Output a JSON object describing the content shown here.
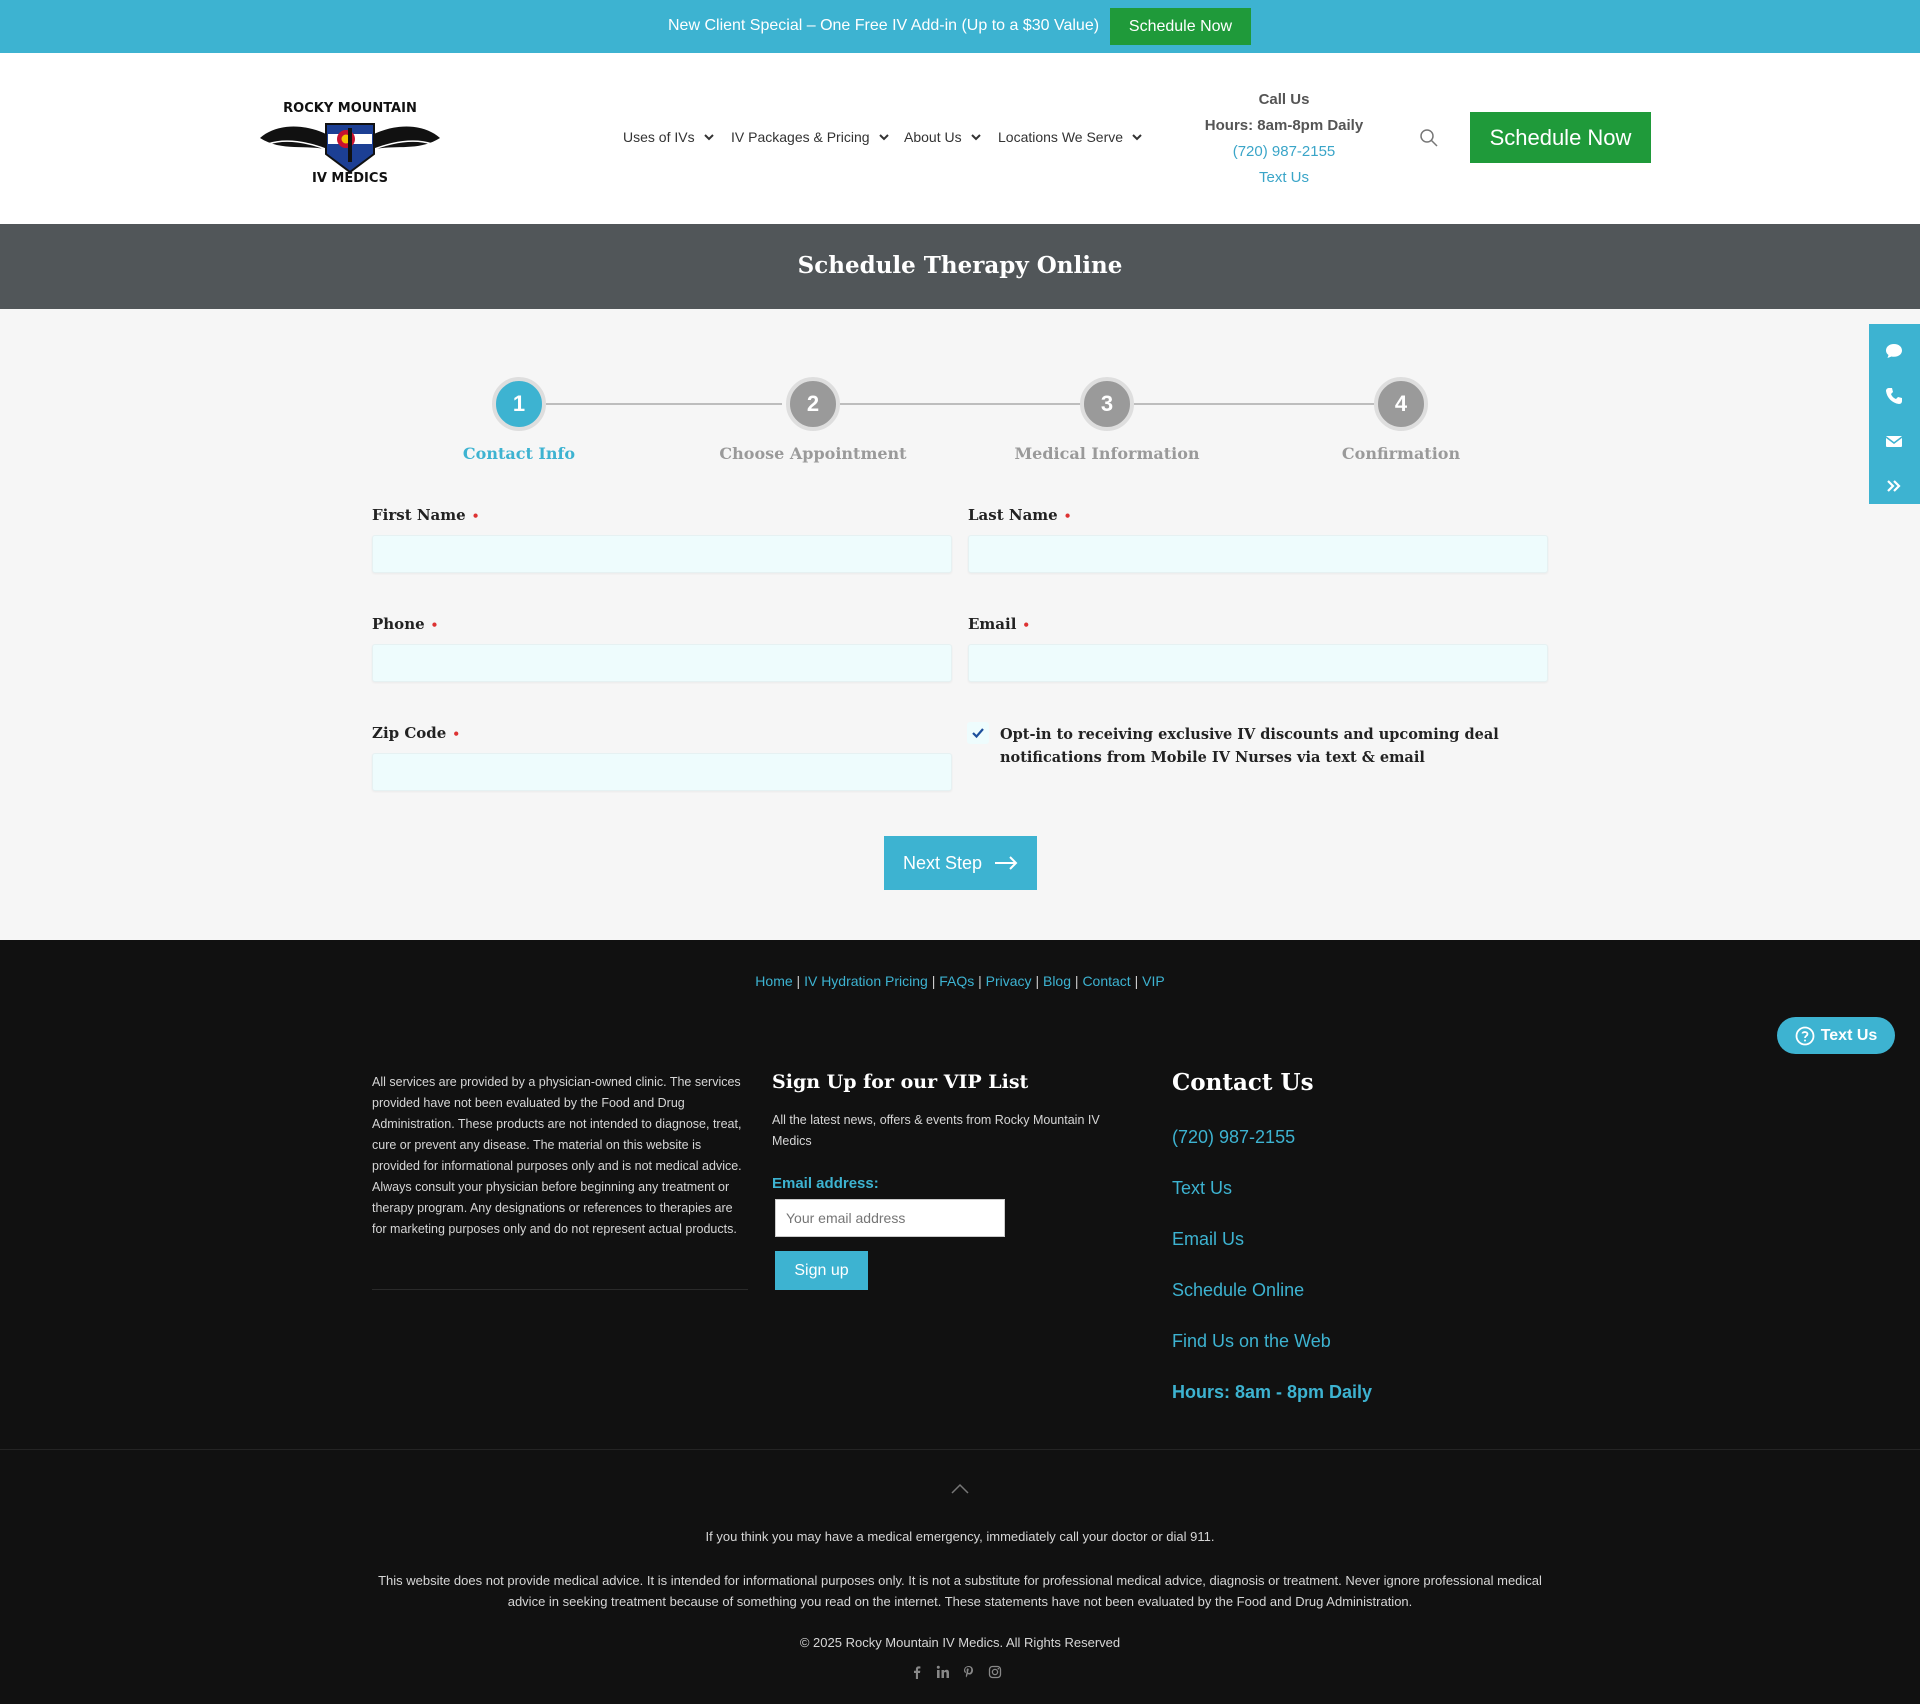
{
  "topbar": {
    "text": "New Client Special – One Free IV Add-in (Up to a $30 Value)",
    "button_label": "Schedule Now"
  },
  "header": {
    "logo_text_top": "ROCKY MOUNTAIN",
    "logo_text_bottom": "IV MEDICS",
    "nav": [
      {
        "label": "Uses of IVs"
      },
      {
        "label": "IV Packages & Pricing"
      },
      {
        "label": "About Us"
      },
      {
        "label": "Locations We Serve"
      }
    ],
    "call_us": "Call Us",
    "hours": "Hours: 8am-8pm Daily",
    "phone": "(720) 987-2155",
    "text_us": "Text Us",
    "schedule_label": "Schedule Now"
  },
  "page_title": "Schedule Therapy Online",
  "steps": [
    {
      "number": "1",
      "label": "Contact Info",
      "active": true
    },
    {
      "number": "2",
      "label": "Choose Appointment",
      "active": false
    },
    {
      "number": "3",
      "label": "Medical Information",
      "active": false
    },
    {
      "number": "4",
      "label": "Confirmation",
      "active": false
    }
  ],
  "form": {
    "first_name_label": "First Name",
    "last_name_label": "Last Name",
    "phone_label": "Phone",
    "email_label": "Email",
    "zip_label": "Zip Code",
    "required_mark": "•",
    "optin_text": "Opt-in to receiving exclusive IV discounts and upcoming deal notifications from Mobile IV Nurses via text & email",
    "optin_checked": true,
    "next_label": "Next Step"
  },
  "footer": {
    "links": [
      "Home",
      "IV Hydration Pricing",
      "FAQs",
      "Privacy",
      "Blog",
      "Contact",
      "VIP"
    ],
    "link_separator": "|",
    "text_us_pill": "Text Us",
    "disclaimer": "All services are provided by a physician-owned clinic. The services provided have not been evaluated by the Food and Drug Administration. These products are not intended to diagnose, treat, cure or prevent any disease. The material on this website is provided for informational purposes only and is not medical advice. Always consult your physician before beginning any treatment or therapy program. Any designations or references to therapies are for marketing purposes only and do not represent actual products.",
    "vip_title": "Sign Up for our VIP List",
    "vip_desc": "All the latest news, offers & events from Rocky Mountain IV Medics",
    "vip_email_label": "Email address:",
    "vip_email_placeholder": "Your email address",
    "vip_signup_label": "Sign up",
    "contact_title": "Contact Us",
    "contact_phone": "(720) 987-2155",
    "contact_text": "Text Us",
    "contact_email": "Email Us",
    "contact_schedule": "Schedule Online",
    "contact_web": "Find Us on the Web",
    "contact_hours": "Hours: 8am - 8pm Daily",
    "emergency": "If you think you may have a medical emergency, immediately call your doctor or dial 911.",
    "advice": "This website does not provide medical advice. It is intended for informational purposes only. It is not a substitute for professional medical advice, diagnosis or treatment. Never ignore professional medical advice in seeking treatment because of something you read on the internet. These statements have not been evaluated by the Food and Drug Administration.",
    "copyright": "© 2025 Rocky Mountain IV Medics. All Rights Reserved",
    "socials": [
      "facebook-icon",
      "linkedin-icon",
      "pinterest-icon",
      "instagram-icon"
    ]
  },
  "colors": {
    "accent": "#3db3d1",
    "green": "#1f9a3a",
    "title_bar": "#515659",
    "footer_bg": "#111111",
    "step_inactive": "#9a9a9a"
  }
}
